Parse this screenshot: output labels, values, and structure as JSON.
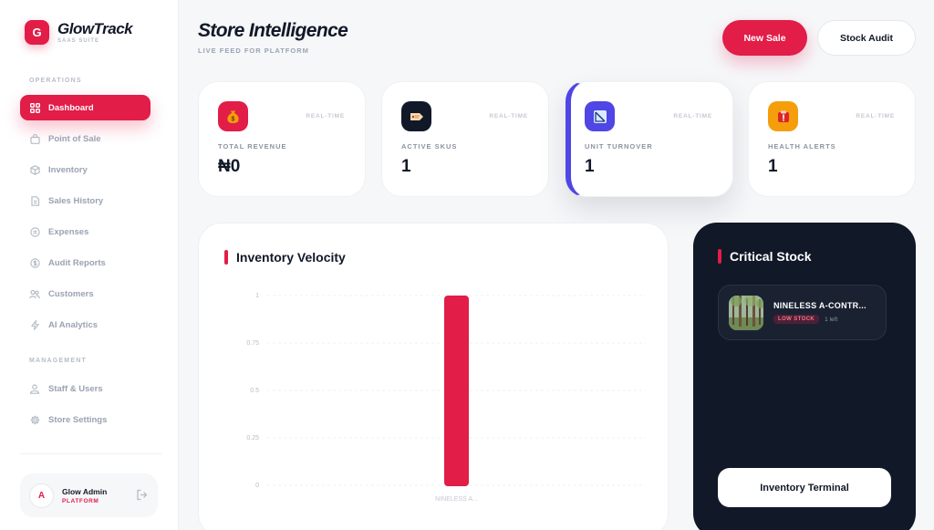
{
  "brand": {
    "name": "GlowTrack",
    "subtitle": "SAAS SUITE",
    "logo_letter": "G"
  },
  "sidebar": {
    "operations_label": "OPERATIONS",
    "management_label": "MANAGEMENT",
    "operations": [
      {
        "label": "Dashboard",
        "icon": "grid-icon",
        "active": true
      },
      {
        "label": "Point of Sale",
        "icon": "bag-icon"
      },
      {
        "label": "Inventory",
        "icon": "box-icon"
      },
      {
        "label": "Sales History",
        "icon": "document-icon"
      },
      {
        "label": "Expenses",
        "icon": "receipt-icon"
      },
      {
        "label": "Audit Reports",
        "icon": "dollar-circle-icon"
      },
      {
        "label": "Customers",
        "icon": "users-icon"
      },
      {
        "label": "AI Analytics",
        "icon": "bolt-icon"
      }
    ],
    "management": [
      {
        "label": "Staff & Users",
        "icon": "user-group-icon"
      },
      {
        "label": "Store Settings",
        "icon": "gear-icon"
      }
    ],
    "user": {
      "initial": "A",
      "name": "Glow Admin",
      "role": "PLATFORM"
    }
  },
  "header": {
    "title": "Store Intelligence",
    "subtitle": "LIVE FEED FOR PLATFORM",
    "primary_button": "New Sale",
    "secondary_button": "Stock Audit"
  },
  "stats": [
    {
      "label": "TOTAL REVENUE",
      "value": "₦0",
      "tag": "REAL-TIME",
      "icon": "money-bag-icon",
      "icon_bg": "#e11d48"
    },
    {
      "label": "ACTIVE SKUS",
      "value": "1",
      "tag": "REAL-TIME",
      "icon": "tag-icon",
      "icon_bg": "#111827"
    },
    {
      "label": "UNIT TURNOVER",
      "value": "1",
      "tag": "REAL-TIME",
      "icon": "chart-icon",
      "icon_bg": "#4f46e5"
    },
    {
      "label": "HEALTH ALERTS",
      "value": "1",
      "tag": "REAL-TIME",
      "icon": "alert-icon",
      "icon_bg": "#f59e0b"
    }
  ],
  "chart_panel": {
    "title": "Inventory Velocity"
  },
  "chart_data": {
    "type": "bar",
    "title": "Inventory Velocity",
    "categories": [
      "NINELESS A..."
    ],
    "values": [
      1
    ],
    "ylim": [
      0,
      1
    ],
    "yticks": [
      "0",
      "0.25",
      "0.5",
      "0.75",
      "1"
    ],
    "grid": true,
    "bar_color": "#e11d48"
  },
  "critical": {
    "title": "Critical Stock",
    "items": [
      {
        "name": "NINELESS A-CONTR...",
        "badge": "LOW STOCK",
        "remaining": "1 left"
      }
    ],
    "button": "Inventory Terminal"
  }
}
